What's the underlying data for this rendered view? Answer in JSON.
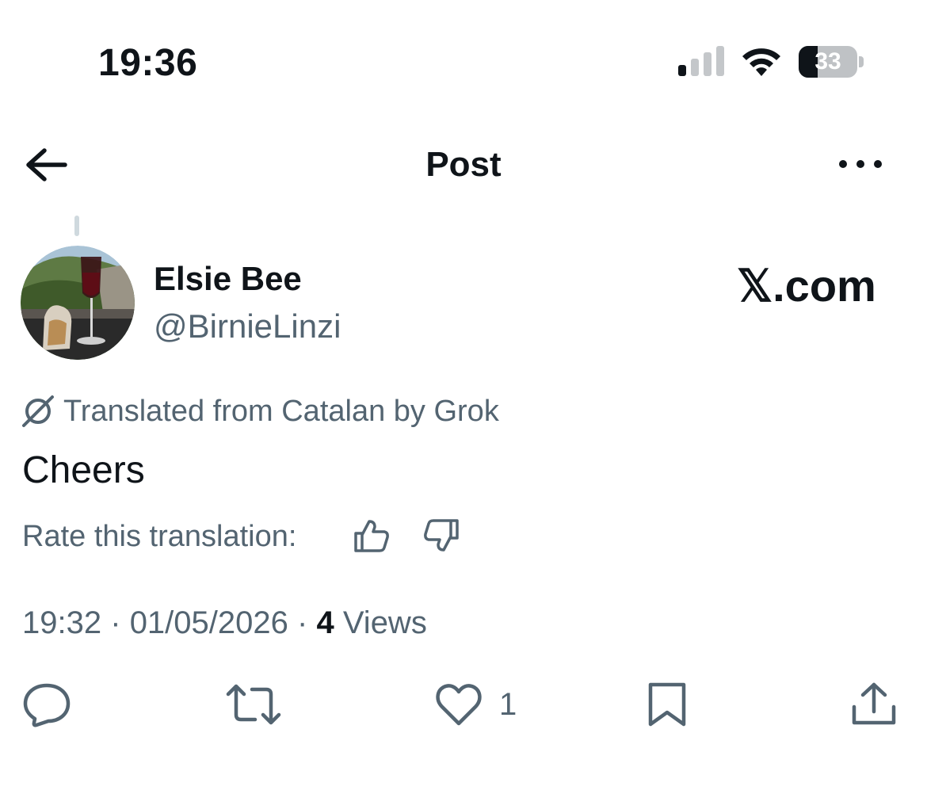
{
  "status_bar": {
    "time": "19:36",
    "battery_level": "33",
    "battery_fraction": 0.33
  },
  "header": {
    "title": "Post"
  },
  "post": {
    "author": {
      "display_name": "Elsie Bee",
      "handle": "@BirnieLinzi"
    },
    "watermark": "𝕏.com",
    "translation_notice": "Translated from Catalan by Grok",
    "text": "Cheers",
    "rate_label": "Rate this translation:",
    "time": "19:32",
    "date": "01/05/2026",
    "views_count": "4",
    "views_label": "Views",
    "separator": "·",
    "like_count": "1"
  },
  "colors": {
    "text_primary": "#0f1419",
    "text_secondary": "#536471",
    "background": "#ffffff"
  },
  "icons": [
    "back-arrow-icon",
    "more-icon",
    "grok-icon",
    "thumbs-up-icon",
    "thumbs-down-icon",
    "reply-icon",
    "repost-icon",
    "like-icon",
    "bookmark-icon",
    "share-icon",
    "signal-icon",
    "wifi-icon",
    "battery-icon"
  ]
}
